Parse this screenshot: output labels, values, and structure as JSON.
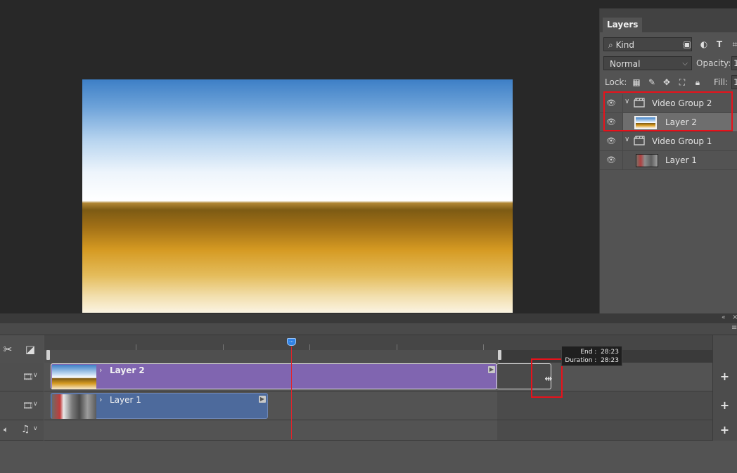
{
  "layers_panel": {
    "tab_label": "Layers",
    "kind_filter": "Kind",
    "blend_mode": "Normal",
    "opacity_label": "Opacity:",
    "opacity_value": "1",
    "lock_label": "Lock:",
    "fill_label": "Fill:",
    "fill_value": "1",
    "layers": [
      {
        "name": "Video Group 2",
        "type": "group",
        "selected": false
      },
      {
        "name": "Layer 2",
        "type": "layer",
        "selected": true
      },
      {
        "name": "Video Group 1",
        "type": "group",
        "selected": false
      },
      {
        "name": "Layer 1",
        "type": "layer",
        "selected": false
      }
    ]
  },
  "timeline": {
    "tracks": [
      {
        "clip_label": "Layer 2"
      },
      {
        "clip_label": "Layer 1"
      }
    ],
    "tooltip": {
      "end_label": "End :",
      "end_value": "28:23",
      "duration_label": "Duration :",
      "duration_value": "28:23"
    },
    "add_label": "+"
  },
  "colors": {
    "highlight": "#e8121b",
    "clip_video2": "#8065b0",
    "clip_video1": "#4d6a9c",
    "playhead": "#e2242b"
  }
}
